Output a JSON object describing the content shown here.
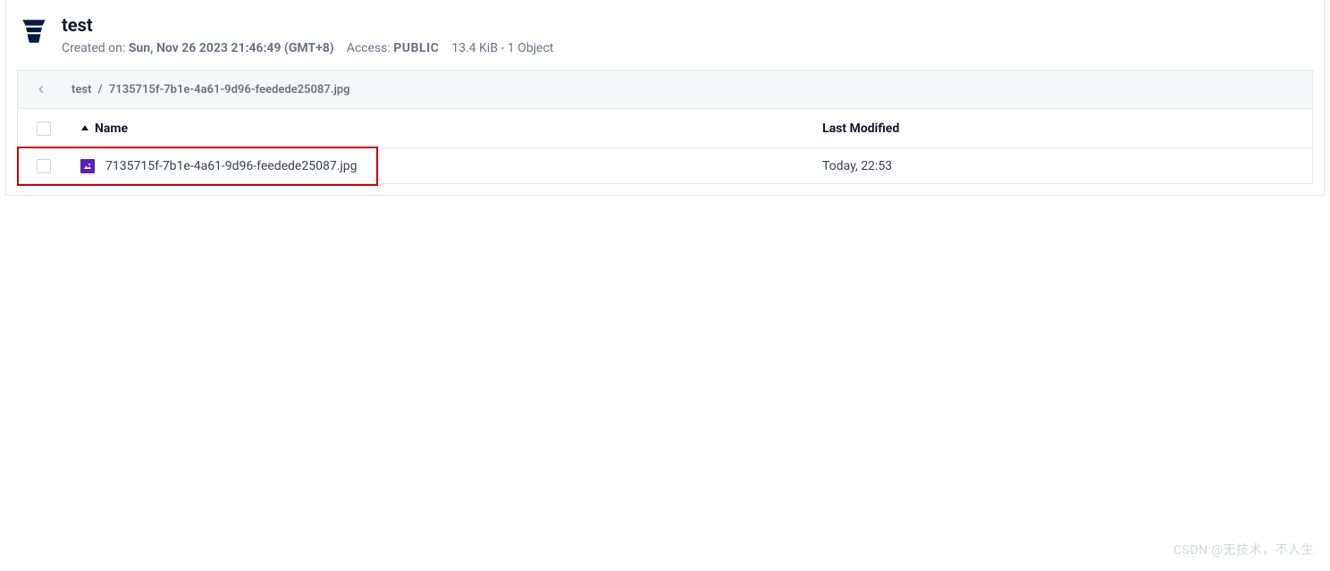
{
  "bucket": {
    "title": "test",
    "created_on_label": "Created on:",
    "created_on_value": "Sun, Nov 26 2023 21:46:49 (GMT+8)",
    "access_label": "Access:",
    "access_value": "PUBLIC",
    "stats": "13.4 KiB - 1 Object"
  },
  "breadcrumb": {
    "root": "test",
    "separator": "/",
    "current": "7135715f-7b1e-4a61-9d96-feedede25087.jpg"
  },
  "table": {
    "columns": {
      "name": "Name",
      "modified": "Last Modified"
    },
    "rows": [
      {
        "filename": "7135715f-7b1e-4a61-9d96-feedede25087.jpg",
        "modified": "Today, 22:53"
      }
    ]
  },
  "watermark": "CSDN @无技术，不人生"
}
